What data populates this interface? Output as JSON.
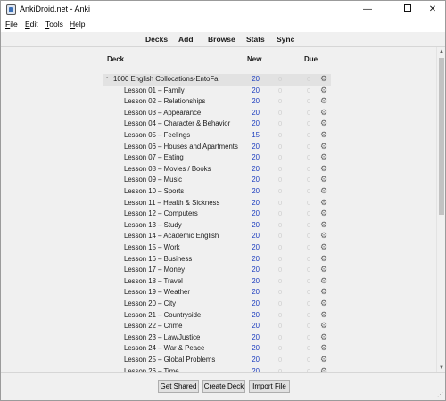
{
  "window": {
    "title": "AnkiDroid.net - Anki",
    "minimize": "—",
    "close": "✕"
  },
  "menu": [
    {
      "label_u": "F",
      "label_rest": "ile"
    },
    {
      "label_u": "E",
      "label_rest": "dit"
    },
    {
      "label_u": "T",
      "label_rest": "ools"
    },
    {
      "label_u": "H",
      "label_rest": "elp"
    }
  ],
  "toolbar": {
    "decks": "Decks",
    "add": "Add",
    "browse": "Browse",
    "stats": "Stats",
    "sync": "Sync"
  },
  "columns": {
    "deck": "Deck",
    "new": "New",
    "due": "Due"
  },
  "decks": [
    {
      "name": "1000 English Collocations-EntoFa",
      "new": "20",
      "learn": "0",
      "due": "0",
      "parent": true,
      "expander": "-"
    },
    {
      "name": "Lesson 01 – Family",
      "new": "20",
      "learn": "0",
      "due": "0"
    },
    {
      "name": "Lesson 02 – Relationships",
      "new": "20",
      "learn": "0",
      "due": "0"
    },
    {
      "name": "Lesson 03 – Appearance",
      "new": "20",
      "learn": "0",
      "due": "0"
    },
    {
      "name": "Lesson 04 – Character & Behavior",
      "new": "20",
      "learn": "0",
      "due": "0"
    },
    {
      "name": "Lesson 05 – Feelings",
      "new": "15",
      "learn": "0",
      "due": "0"
    },
    {
      "name": "Lesson 06 – Houses and Apartments",
      "new": "20",
      "learn": "0",
      "due": "0"
    },
    {
      "name": "Lesson 07 – Eating",
      "new": "20",
      "learn": "0",
      "due": "0"
    },
    {
      "name": "Lesson 08 – Movies / Books",
      "new": "20",
      "learn": "0",
      "due": "0"
    },
    {
      "name": "Lesson 09 – Music",
      "new": "20",
      "learn": "0",
      "due": "0"
    },
    {
      "name": "Lesson 10 – Sports",
      "new": "20",
      "learn": "0",
      "due": "0"
    },
    {
      "name": "Lesson 11 – Health & Sickness",
      "new": "20",
      "learn": "0",
      "due": "0"
    },
    {
      "name": "Lesson 12 – Computers",
      "new": "20",
      "learn": "0",
      "due": "0"
    },
    {
      "name": "Lesson 13 – Study",
      "new": "20",
      "learn": "0",
      "due": "0"
    },
    {
      "name": "Lesson 14 – Academic English",
      "new": "20",
      "learn": "0",
      "due": "0"
    },
    {
      "name": "Lesson 15 – Work",
      "new": "20",
      "learn": "0",
      "due": "0"
    },
    {
      "name": "Lesson 16 – Business",
      "new": "20",
      "learn": "0",
      "due": "0"
    },
    {
      "name": "Lesson 17 – Money",
      "new": "20",
      "learn": "0",
      "due": "0"
    },
    {
      "name": "Lesson 18 – Travel",
      "new": "20",
      "learn": "0",
      "due": "0"
    },
    {
      "name": "Lesson 19 – Weather",
      "new": "20",
      "learn": "0",
      "due": "0"
    },
    {
      "name": "Lesson 20 – City",
      "new": "20",
      "learn": "0",
      "due": "0"
    },
    {
      "name": "Lesson 21 – Countryside",
      "new": "20",
      "learn": "0",
      "due": "0"
    },
    {
      "name": "Lesson 22 – Crime",
      "new": "20",
      "learn": "0",
      "due": "0"
    },
    {
      "name": "Lesson 23 – Law/Justice",
      "new": "20",
      "learn": "0",
      "due": "0"
    },
    {
      "name": "Lesson 24 – War & Peace",
      "new": "20",
      "learn": "0",
      "due": "0"
    },
    {
      "name": "Lesson 25 – Global Problems",
      "new": "20",
      "learn": "0",
      "due": "0"
    },
    {
      "name": "Lesson 26 – Time",
      "new": "20",
      "learn": "0",
      "due": "0"
    }
  ],
  "bottom": {
    "get_shared": "Get Shared",
    "create_deck": "Create Deck",
    "import_file": "Import File"
  },
  "icons": {
    "gear": "gear-icon",
    "expander": "collapse-icon",
    "app": "anki-app-icon"
  },
  "colors": {
    "new_count": "#1f3fbf",
    "zero_count": "#cfcfcf",
    "parent_row_bg": "#e2e2e2"
  }
}
